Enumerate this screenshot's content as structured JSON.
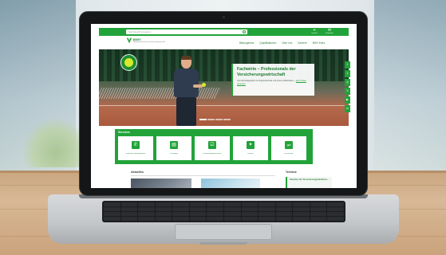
{
  "website": {
    "search_placeholder": "Suchbegriff eingeben",
    "topbar_utils": [
      {
        "icon": "map-pin-icon",
        "glyph": "⌖",
        "label": "Kontakt"
      },
      {
        "icon": "mail-icon",
        "glyph": "✉",
        "label": "Newsletter"
      }
    ],
    "logo": {
      "name": "BWV",
      "subtitle": "Bildungsverband der Versicherungswirtschaft"
    },
    "nav": [
      "Bildungsnetz",
      "Qualifikationen",
      "Über uns",
      "Karriere",
      "BWV Extra"
    ],
    "hero": {
      "title": "Fachwirte – Professionals der Versicherungswirtschaft",
      "text": "Vom Einsteigerjob zur Expertenrolle mit einem Abschluss –",
      "link": "jetzt Video ansehen"
    },
    "social": [
      {
        "icon": "facebook-icon",
        "glyph": "f"
      },
      {
        "icon": "xing-icon",
        "glyph": "x"
      },
      {
        "icon": "instagram-icon",
        "glyph": "◎"
      },
      {
        "icon": "x-icon",
        "glyph": "𝕏"
      },
      {
        "icon": "youtube-icon",
        "glyph": "▶"
      },
      {
        "icon": "linkedin-icon",
        "glyph": "in"
      }
    ],
    "services": {
      "label": "Services",
      "tiles": [
        {
          "icon": "phone-icon",
          "glyph": "✆",
          "label": "Regionale Bildungswerke"
        },
        {
          "icon": "document-icon",
          "glyph": "▤",
          "label": "Prüfungen"
        },
        {
          "icon": "checklist-icon",
          "glyph": "☑",
          "label": "Weiterbildungsnachweis"
        },
        {
          "icon": "people-icon",
          "glyph": "✦",
          "label": "Karriere"
        },
        {
          "icon": "quiz-icon",
          "glyph": "gut",
          "label": "Gut beraten"
        }
      ]
    },
    "news_label": "Aktuelles",
    "seminar": {
      "label": "Termine",
      "text": "Seminar für Versicherungsfachfrau..."
    }
  },
  "colors": {
    "brand_green": "#22a33a",
    "dark_green": "#1f7e31"
  }
}
